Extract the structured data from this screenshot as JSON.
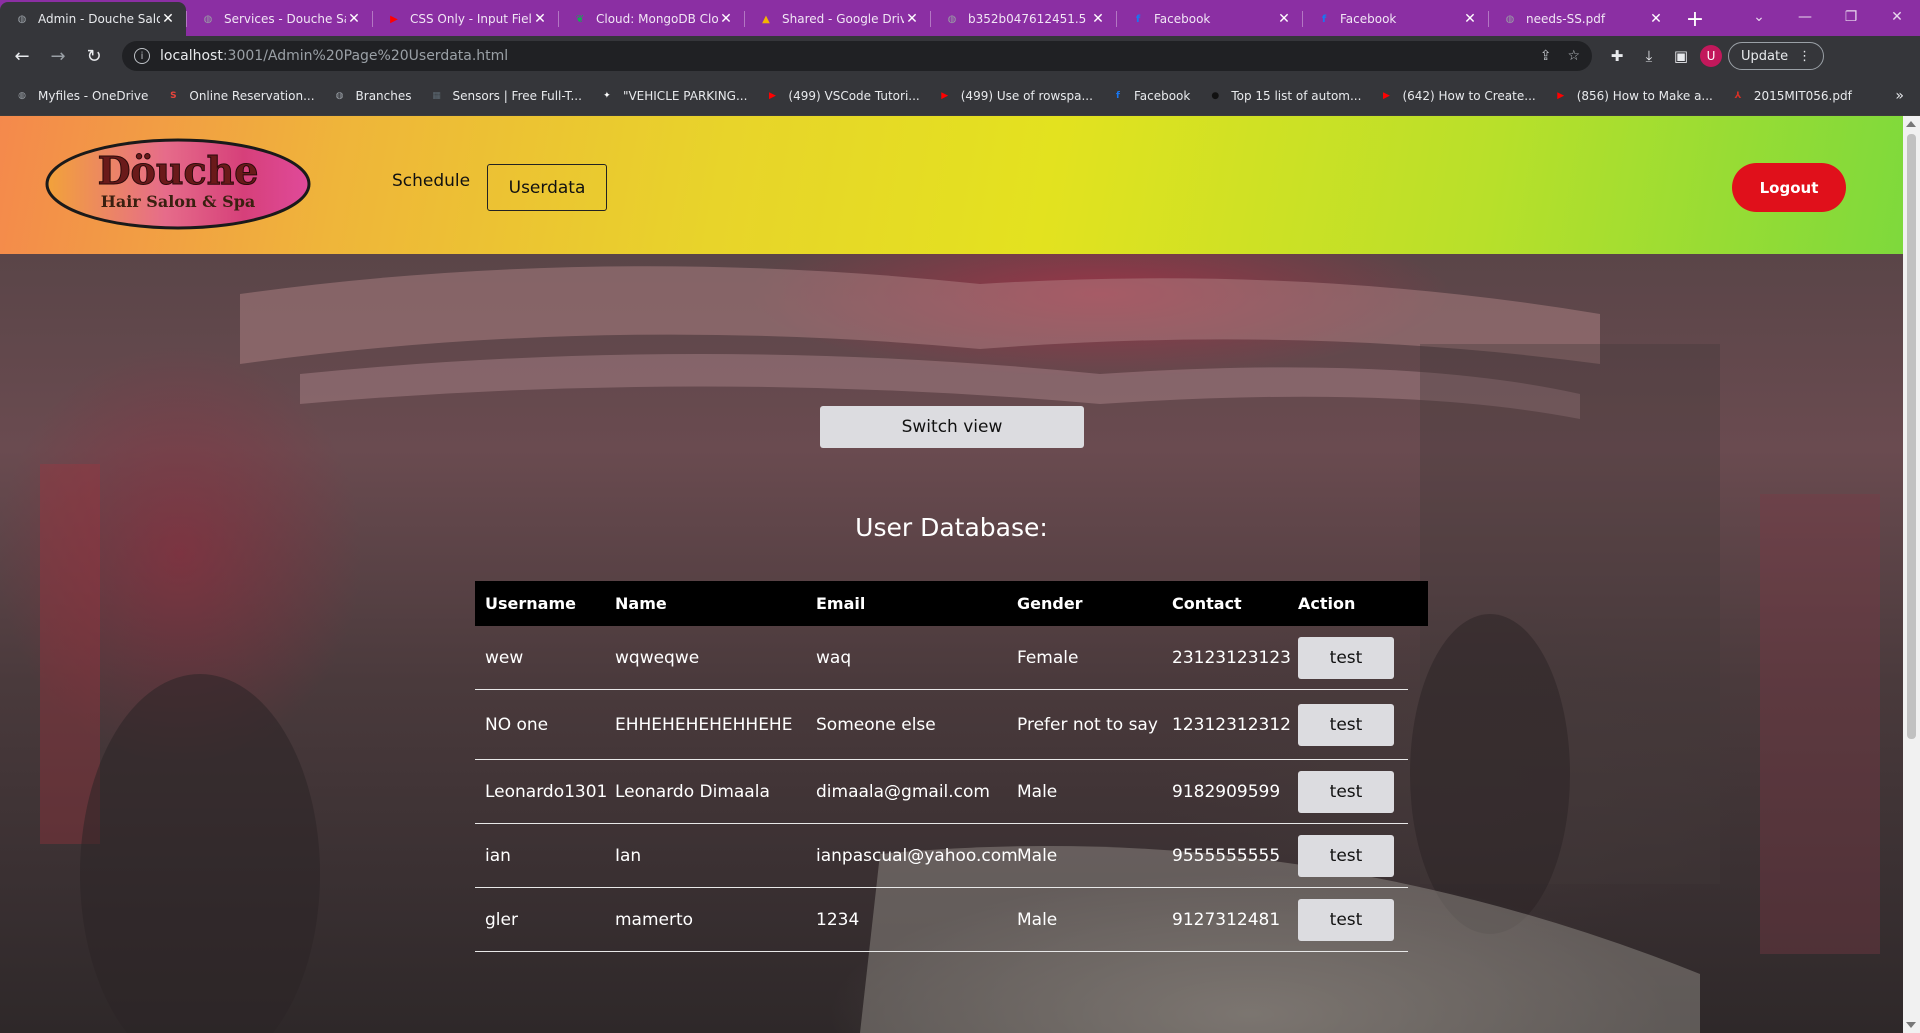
{
  "browser": {
    "tabs": [
      {
        "title": "Admin - Douche Salon",
        "active": true,
        "favicon": "globe-icon",
        "color": "#9aa0a6"
      },
      {
        "title": "Services - Douche Salon",
        "active": false,
        "favicon": "globe-icon",
        "color": "#9aa0a6"
      },
      {
        "title": "CSS Only - Input Field",
        "active": false,
        "favicon": "youtube-icon",
        "color": "#ff0000"
      },
      {
        "title": "Cloud: MongoDB Cloud",
        "active": false,
        "favicon": "mongodb-leaf-icon",
        "color": "#13aa52"
      },
      {
        "title": "Shared - Google Drive",
        "active": false,
        "favicon": "google-drive-icon",
        "color": "#f4b400"
      },
      {
        "title": "b352b047612451.5",
        "active": false,
        "favicon": "globe-icon",
        "color": "#9aa0a6"
      },
      {
        "title": "Facebook",
        "active": false,
        "favicon": "facebook-icon",
        "color": "#1877f2"
      },
      {
        "title": "Facebook",
        "active": false,
        "favicon": "facebook-icon",
        "color": "#1877f2"
      },
      {
        "title": "needs-SS.pdf",
        "active": false,
        "favicon": "globe-icon",
        "color": "#9aa0a6"
      }
    ],
    "new_tab": "+",
    "url_host": "localhost",
    "url_rest": ":3001/Admin%20Page%20Userdata.html",
    "update_label": "Update",
    "profile_initial": "U",
    "bookmarks": [
      {
        "label": "Myfiles - OneDrive",
        "icon": "globe-icon",
        "color": "#9aa0a6"
      },
      {
        "label": "Online Reservation...",
        "icon": "reservation-icon",
        "color": "#e8453c"
      },
      {
        "label": "Branches",
        "icon": "globe-icon",
        "color": "#9aa0a6"
      },
      {
        "label": "Sensors | Free Full-T...",
        "icon": "mdpi-icon",
        "color": "#5b6770"
      },
      {
        "label": "\"VEHICLE PARKING...",
        "icon": "sciencedirect-icon",
        "color": "#ffffff"
      },
      {
        "label": "(499) VSCode Tutori...",
        "icon": "youtube-icon",
        "color": "#ff0000"
      },
      {
        "label": "(499) Use of rowspa...",
        "icon": "youtube-icon",
        "color": "#ff0000"
      },
      {
        "label": "Facebook",
        "icon": "facebook-icon",
        "color": "#1877f2"
      },
      {
        "label": "Top 15 list of autom...",
        "icon": "medium-icon",
        "color": "#111111"
      },
      {
        "label": "(642) How to Create...",
        "icon": "youtube-icon",
        "color": "#ff0000"
      },
      {
        "label": "(856) How to Make a...",
        "icon": "youtube-icon",
        "color": "#ff0000"
      },
      {
        "label": "2015MIT056.pdf",
        "icon": "pdf-icon",
        "color": "#d93025"
      }
    ],
    "bookmarks_more": "»"
  },
  "header": {
    "logo_text_top": "Döuche",
    "logo_text_bottom": "Hair Salon & Spa",
    "nav_schedule": "Schedule",
    "nav_userdata": "Userdata",
    "logout": "Logout"
  },
  "main": {
    "switch_view": "Switch view",
    "title": "User Database:",
    "columns": [
      "Username",
      "Name",
      "Email",
      "Gender",
      "Contact",
      "Action"
    ],
    "rows": [
      {
        "username": "wew",
        "name": "wqweqwe",
        "email": "waq",
        "gender": "Female",
        "contact": "23123123123",
        "action": "test"
      },
      {
        "username": "NO one",
        "name": "EHHEHEHEHEHHEHE",
        "email": "Someone else",
        "gender": "Prefer not to say",
        "contact": "12312312312",
        "action": "test"
      },
      {
        "username": "Leonardo1301",
        "name": "Leonardo Dimaala",
        "email": "dimaala@gmail.com",
        "gender": "Male",
        "contact": "9182909599",
        "action": "test"
      },
      {
        "username": "ian",
        "name": "Ian",
        "email": "ianpascual@yahoo.com",
        "gender": "Male",
        "contact": "9555555555",
        "action": "test"
      },
      {
        "username": "gler",
        "name": "mamerto",
        "email": "1234",
        "gender": "Male",
        "contact": "9127312481",
        "action": "test"
      }
    ]
  }
}
